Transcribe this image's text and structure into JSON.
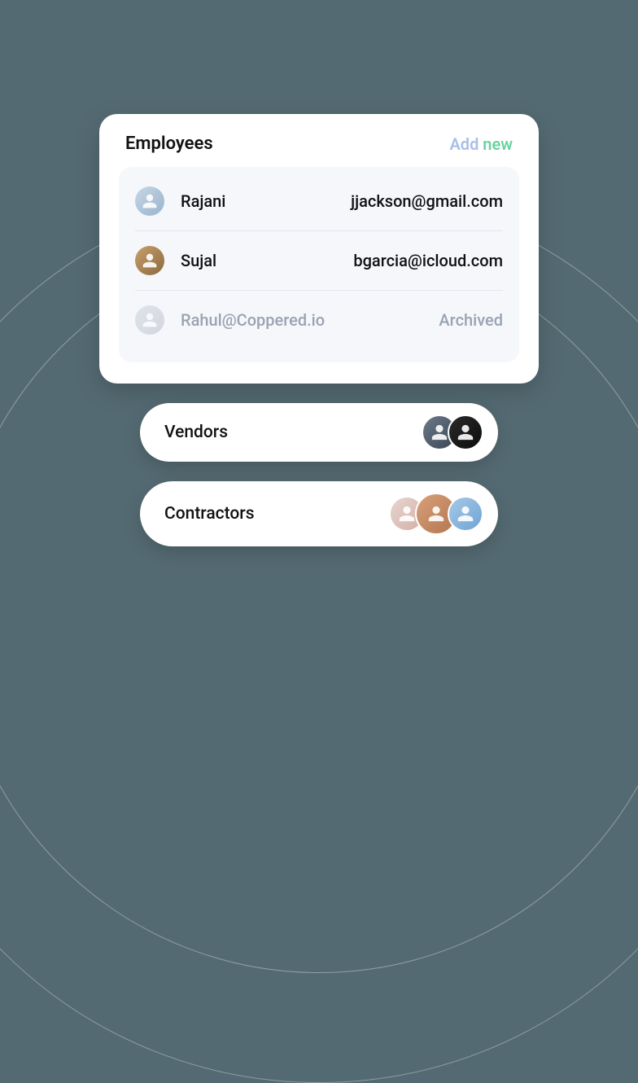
{
  "employees": {
    "title": "Employees",
    "add_word1": "Add",
    "add_word2": " new",
    "rows": [
      {
        "name": "Rajani",
        "email": "jjackson@gmail.com",
        "archived": false
      },
      {
        "name": "Sujal",
        "email": "bgarcia@icloud.com",
        "archived": false
      },
      {
        "name": "Rahul@Coppered.io",
        "email": "",
        "archived": true,
        "tag": "Archived"
      }
    ]
  },
  "groups": [
    {
      "title": "Vendors",
      "avatar_count": 2
    },
    {
      "title": "Contractors",
      "avatar_count": 3
    }
  ]
}
